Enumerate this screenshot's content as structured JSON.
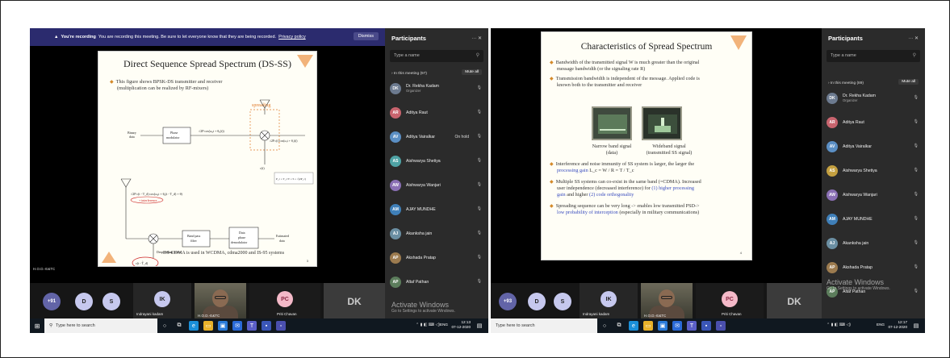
{
  "left": {
    "recording_title": "You're recording",
    "recording_text": "You are recording this meeting. Be sure to let everyone know that they are being recorded.",
    "privacy_link": "Privacy policy",
    "dismiss_label": "Dismiss",
    "slide": {
      "title": "Direct Sequence Spread Spectrum (DS-SS)",
      "bullet1": "This figure shows BPSK-DS transmitter and receiver",
      "bullet1b": "(multiplication can be realized by RF-mixers)",
      "spreading_label": "spreading",
      "diagram": {
        "binary_data": "Binary",
        "binary_data2": "data",
        "phase_modulator": "Phase",
        "phase_modulator2": "modulator",
        "carrier": "√2P cos(ω₀t + θ₀(t))",
        "spread_out": "√2P c(t) cos(ω₀t + θ₀(t))",
        "ct": "c(t)",
        "formula": "P_c = T_c/T = S = √(2P_c)",
        "rx_signal": "√2P c(t - T_d) cos(ω₀t + θ₀(t - T_d) + θ)",
        "interference": "+ interference",
        "bandpass": "Band pass",
        "bandpass2": "filter",
        "data_phase": "Data",
        "data_phase2": "phase",
        "data_phase3": "demodulator",
        "estimated": "Estimated",
        "estimated2": "data",
        "despreading": "Despreading mixer",
        "local_code": "c(t - T̂_d)"
      },
      "bottom_text": "DS-CDMA is used in WCDMA, cdma2000 and IS-95 systems",
      "page": "3"
    },
    "participants": {
      "title": "Participants",
      "controls": "···  ✕",
      "search_placeholder": "Type a name",
      "section": "› In this meeting (97)",
      "mute_all": "Mute all",
      "list": [
        {
          "initials": "DK",
          "name": "Dr. Rekha Kadam",
          "sub": "Organizer",
          "color": "#6c7a8f",
          "status": ""
        },
        {
          "initials": "AR",
          "name": "Aditya Raut",
          "sub": "",
          "color": "#c8646e",
          "status": ""
        },
        {
          "initials": "AV",
          "name": "Aditya Vairalkar",
          "sub": "",
          "color": "#5b8fc4",
          "status": "On hold"
        },
        {
          "initials": "AS",
          "name": "Aishwarya Shetiya",
          "sub": "",
          "color": "#4fa3a5",
          "status": ""
        },
        {
          "initials": "AW",
          "name": "Aishwarya Wanjari",
          "sub": "",
          "color": "#8a6fb4",
          "status": ""
        },
        {
          "initials": "AM",
          "name": "AJAY MUNDHE",
          "sub": "",
          "color": "#3f7fb8",
          "status": ""
        },
        {
          "initials": "AJ",
          "name": "Akanksha jain",
          "sub": "",
          "color": "#6b8fa3",
          "status": ""
        },
        {
          "initials": "AP",
          "name": "Akshada Pratap",
          "sub": "",
          "color": "#9c7b4f",
          "status": ""
        },
        {
          "initials": "AP",
          "name": "Altaf Pathan",
          "sub": "",
          "color": "#5c7d5c",
          "status": ""
        }
      ]
    },
    "presenter_label": "H.O.D.-E&TC",
    "strip": {
      "more": "+91",
      "t1": "D",
      "t2": "S",
      "t3": "IK",
      "t3_name": "Indrayani kadam",
      "cam_name": "H.O.D.-E&TC",
      "t5": "PC",
      "t5_name": "Priti Chavan",
      "t6": "DK"
    },
    "watermark": "Activate Windows",
    "watermark_sub": "Go to Settings to activate Windows.",
    "taskbar": {
      "search": "Type here to search",
      "time": "12:13",
      "date": "07-12-2020",
      "lang": "ENG"
    }
  },
  "right": {
    "slide": {
      "title": "Characteristics of Spread Spectrum",
      "b1": "Bandwidth of the transmitted signal W is much greater than the original",
      "b1b": "message bandwidth (or the signaling rate R)",
      "b2": "Transmission bandwidth is independent of the message. Applied code is",
      "b2b": "known both to the transmitter and receiver",
      "cap1": "Narrow band signal",
      "cap1b": "(data)",
      "cap2": "Wideband signal",
      "cap2b": "(transmitted SS signal)",
      "b3": "Interference and noise immunity of SS system is larger, the larger the",
      "b3b_pre": "processing gain",
      "b3b_post": "L_c = W / R = T / T_c",
      "b4": "Multiple SS systems can co-exist in the same band (=CDMA). Increased",
      "b4b": "user independence (decreased interference) for",
      "b4b_blue": "(1) higher processing",
      "b4c_blue": "gain",
      "b4c": "and higher",
      "b4c_blue2": "(2) code orthogonality",
      "b5": "Spreading sequence can be very long -> enables low transmitted PSD->",
      "b5b_blue": "low probability of interception",
      "b5b": "(especially in military communications)",
      "page": "4"
    },
    "participants": {
      "title": "Participants",
      "controls": "···  ✕",
      "search_placeholder": "Type a name",
      "section": "› In this meeting (89)",
      "mute_all": "Mute all",
      "list": [
        {
          "initials": "DK",
          "name": "Dr. Rekha Kadam",
          "sub": "Organizer",
          "color": "#6c7a8f"
        },
        {
          "initials": "AR",
          "name": "Aditya Raut",
          "sub": "",
          "color": "#c8646e"
        },
        {
          "initials": "AV",
          "name": "Aditya Vairalkar",
          "sub": "",
          "color": "#5b8fc4"
        },
        {
          "initials": "AS",
          "name": "Aishwarya Shetiya",
          "sub": "",
          "color": "#c4a040"
        },
        {
          "initials": "AW",
          "name": "Aishwarya Wanjari",
          "sub": "",
          "color": "#8a6fb4"
        },
        {
          "initials": "AM",
          "name": "AJAY MUNDHE",
          "sub": "",
          "color": "#3f7fb8"
        },
        {
          "initials": "AJ",
          "name": "Akanksha jain",
          "sub": "",
          "color": "#6b8fa3"
        },
        {
          "initials": "AP",
          "name": "Akshada Pratap",
          "sub": "",
          "color": "#9c7b4f"
        },
        {
          "initials": "AP",
          "name": "Altaf Pathan",
          "sub": "",
          "color": "#5c7d5c"
        }
      ]
    },
    "strip": {
      "more": "+93",
      "t1": "D",
      "t2": "S",
      "t3": "IK",
      "t3_name": "Indrayani kadam",
      "cam_name": "H.O.D.-E&TC",
      "t5": "PC",
      "t5_name": "Priti Chavan",
      "t6": "DK"
    },
    "watermark": "Activate Windows",
    "watermark_sub": "Go to Settings to activate Windows.",
    "taskbar": {
      "search": "Type here to search",
      "time": "12:17",
      "date": "07-12-2020",
      "lang": "ENG"
    }
  }
}
